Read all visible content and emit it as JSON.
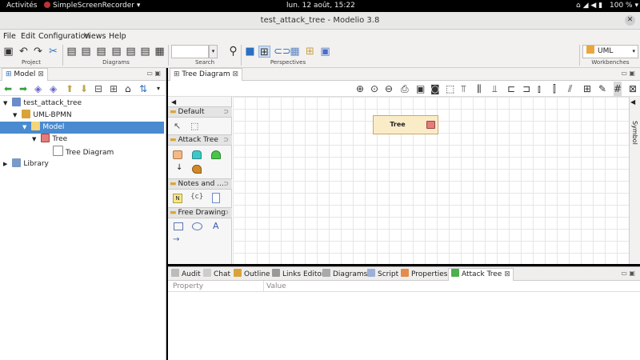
{
  "topbar": {
    "activities": "Activités",
    "app": "SimpleScreenRecorder ▾",
    "clock": "lun. 12 août, 15:22",
    "battery": "100 % ▾"
  },
  "window": {
    "title": "test_attack_tree - Modelio 3.8",
    "close": "✕"
  },
  "menu": [
    "File",
    "Edit",
    "Configuration",
    "Views",
    "Help"
  ],
  "toolbar": {
    "groups": {
      "project": "Project",
      "diagrams": "Diagrams",
      "search": "Search",
      "perspectives": "Perspectives",
      "workbenches": "Workbenches"
    },
    "search_value": "",
    "workbench_value": "UML"
  },
  "model_pane": {
    "tab": "Model",
    "tree": [
      {
        "label": "test_attack_tree",
        "icon": "project-icon"
      },
      {
        "label": "UML-BPMN",
        "icon": "package-icon"
      },
      {
        "label": "Model",
        "icon": "folder-icon",
        "selected": true
      },
      {
        "label": "Tree",
        "icon": "tree-icon"
      },
      {
        "label": "Tree Diagram",
        "icon": "diagram-icon"
      },
      {
        "label": "Library",
        "icon": "library-icon"
      }
    ]
  },
  "editor": {
    "tab": "Tree Diagram",
    "symbol_label": "Symbol",
    "palette": {
      "default": "Default",
      "attack_tree": "Attack Tree",
      "notes": "Notes and ...",
      "free_drawing": "Free Drawing",
      "constraint_glyph": "{c}",
      "note_glyph": "N",
      "text_glyph": "A"
    },
    "node_label": "Tree"
  },
  "bottom": {
    "tabs": [
      "Audit",
      "Chat",
      "Outline",
      "Links Editor",
      "Diagrams",
      "Script",
      "Properties",
      "Attack Tree"
    ],
    "columns": {
      "property": "Property",
      "value": "Value"
    }
  },
  "colors": {
    "selection": "#4a8ad0",
    "node_fill": "#fbecc8",
    "node_icon": "#e47c7c",
    "palette_header": "#e4e4e4"
  }
}
